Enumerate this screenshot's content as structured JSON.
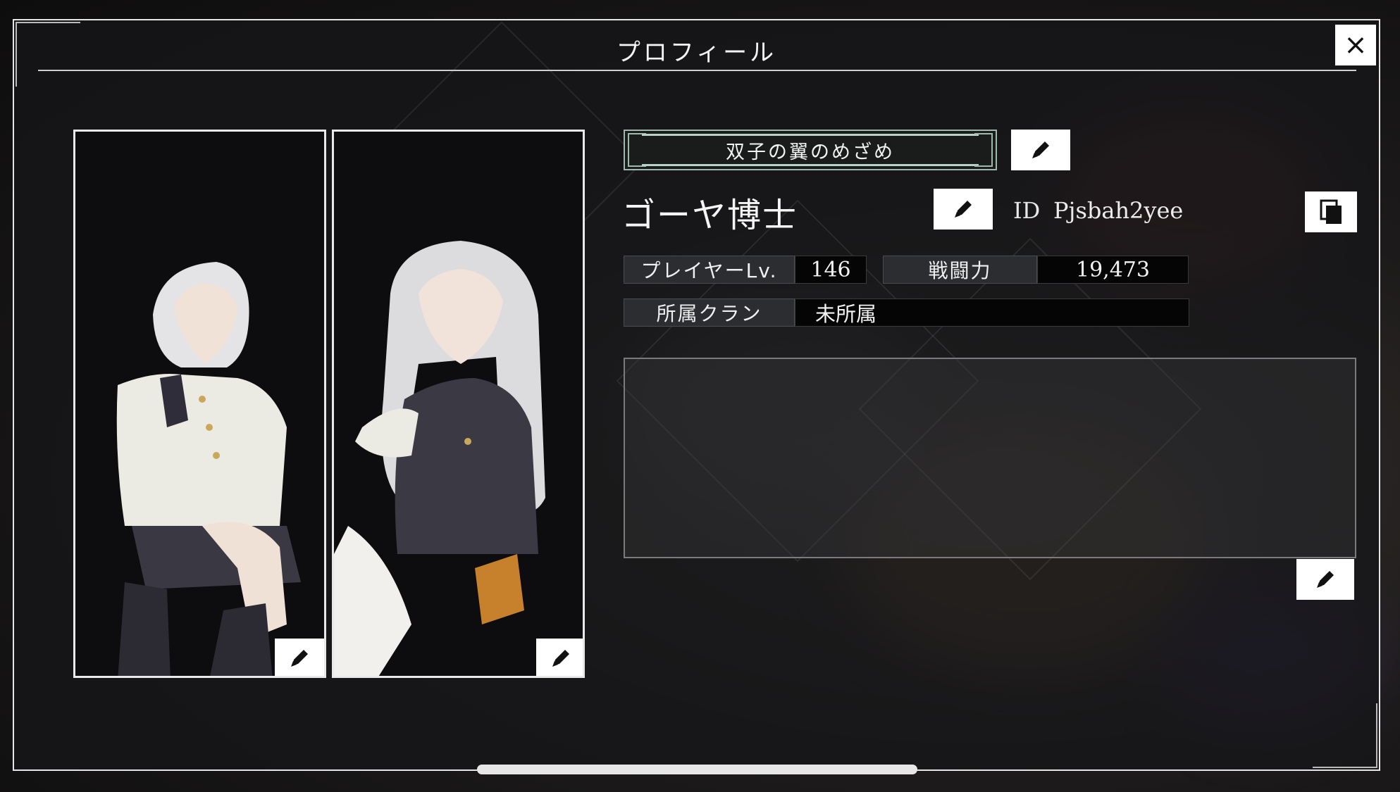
{
  "modal": {
    "title": "プロフィール",
    "close_label": "×"
  },
  "profile": {
    "title_badge": "双子の翼のめざめ",
    "player_name": "ゴーヤ博士",
    "id_label": "ID",
    "id_value": "Pjsbah2yee",
    "stats": {
      "level_label": "プレイヤーLv.",
      "level_value": "146",
      "power_label": "戦闘力",
      "power_value": "19,473",
      "clan_label": "所属クラン",
      "clan_value": "未所属"
    },
    "comment": ""
  },
  "icons": {
    "edit": "pencil-icon",
    "copy": "copy-icon",
    "close": "close-icon"
  },
  "colors": {
    "frame": "#e6e6e6",
    "banner_border": "#9fb8ae",
    "button_bg": "#ffffff",
    "panel_bg": "#161618"
  }
}
